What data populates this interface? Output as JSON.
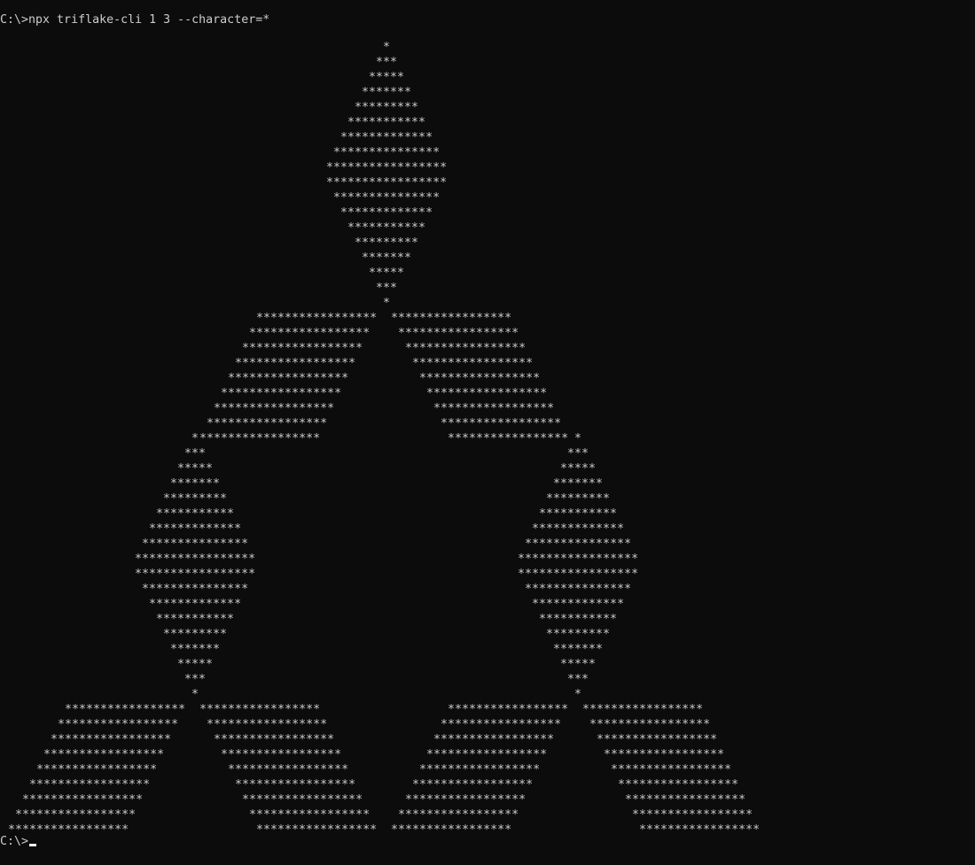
{
  "window": {
    "background": "#0c0c0c",
    "text_color": "#cccccc"
  },
  "command_line": {
    "prompt": "C:\\>",
    "command": "npx triflake-cli 1 3 --character=*"
  },
  "output": {
    "character": "*",
    "segments": [
      {
        "col": 0,
        "run": 1
      },
      {
        "col": -1,
        "run": 3
      },
      {
        "col": -2,
        "run": 5
      },
      {
        "col": -3,
        "run": 7
      },
      {
        "col": -4,
        "run": 9
      },
      {
        "col": -5,
        "run": 11
      },
      {
        "col": -6,
        "run": 13
      },
      {
        "col": -7,
        "run": 15
      },
      {
        "col": -8,
        "run": 17
      },
      {
        "col": -8,
        "run": 17
      },
      {
        "col": -7,
        "run": 15
      },
      {
        "col": -6,
        "run": 13
      },
      {
        "col": -5,
        "run": 11
      },
      {
        "col": -4,
        "run": 9
      },
      {
        "col": -3,
        "run": 7
      },
      {
        "col": -2,
        "run": 5
      },
      {
        "col": -1,
        "run": 3
      },
      {
        "col": 0,
        "run": 1
      }
    ]
  },
  "final_prompt": {
    "prompt": "C:\\>"
  }
}
